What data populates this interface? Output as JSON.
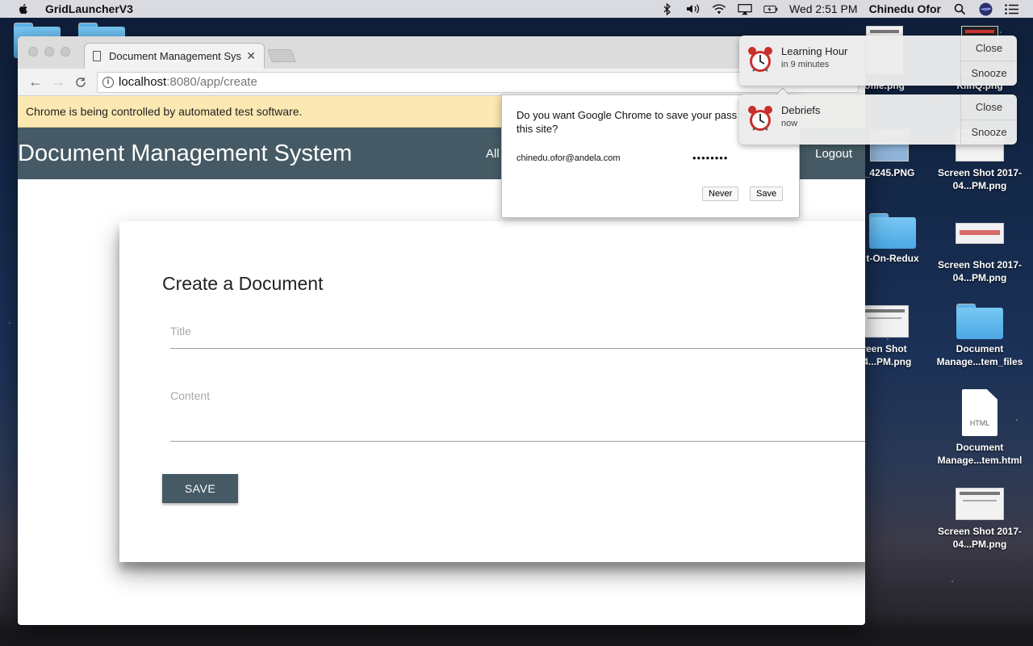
{
  "menubar": {
    "app_name": "GridLauncherV3",
    "clock": "Wed 2:51 PM",
    "user": "Chinedu Ofor",
    "icons": [
      "apple-icon",
      "bluetooth-icon",
      "volume-icon",
      "wifi-icon",
      "airplay-icon",
      "battery-icon",
      "spotlight-icon",
      "siri-icon",
      "notification-center-icon"
    ]
  },
  "desktop": {
    "items": [
      {
        "label": "ofile.png",
        "kind": "image"
      },
      {
        "label": "KlinQ.png",
        "kind": "image"
      },
      {
        "label": "_4245.PNG",
        "kind": "image"
      },
      {
        "label": "Screen Shot 2017-04...PM.png",
        "kind": "screenshot"
      },
      {
        "label": "t-On-Redux",
        "kind": "folder"
      },
      {
        "label": "Screen Shot 2017-04...PM.png",
        "kind": "screenshot"
      },
      {
        "label": "reen Shot 04...PM.png",
        "kind": "screenshot"
      },
      {
        "label": "Document Manage...tem_files",
        "kind": "folder"
      },
      {
        "label": "Document Manage...tem.html",
        "kind": "html"
      },
      {
        "label": "Screen Shot 2017-04...PM.png",
        "kind": "screenshot"
      }
    ],
    "html_tag": "HTML"
  },
  "browser": {
    "tab_title": "Document Management Syster",
    "url_host": "localhost",
    "url_rest": ":8080/app/create",
    "infobar_text": "Chrome is being controlled by automated test software."
  },
  "app": {
    "brand": "Document Management System",
    "nav_all": "All",
    "nav_logout": "Logout",
    "form": {
      "heading": "Create a Document",
      "title_placeholder": "Title",
      "content_placeholder": "Content",
      "save_label": "SAVE"
    }
  },
  "password_prompt": {
    "question": "Do you want Google Chrome to save your pass for this site?",
    "username": "chinedu.ofor@andela.com",
    "password_mask": "••••••••",
    "never_label": "Never",
    "save_label": "Save"
  },
  "notifications": [
    {
      "title": "Learning Hour",
      "subtitle": "in 9 minutes",
      "close": "Close",
      "snooze": "Snooze"
    },
    {
      "title": "Debriefs",
      "subtitle": "now",
      "close": "Close",
      "snooze": "Snooze"
    }
  ],
  "colors": {
    "app_bar": "#455a64",
    "infobar": "#fce8b2"
  }
}
